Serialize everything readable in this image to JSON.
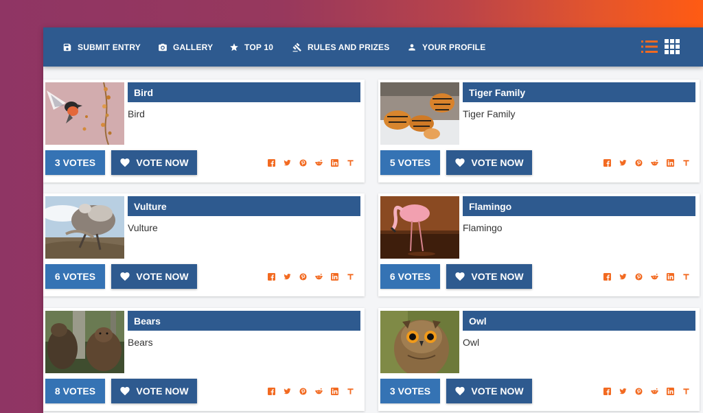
{
  "nav": {
    "items": [
      {
        "label": "SUBMIT ENTRY",
        "icon": "save-icon"
      },
      {
        "label": "GALLERY",
        "icon": "camera-icon"
      },
      {
        "label": "TOP 10",
        "icon": "star-icon"
      },
      {
        "label": "RULES AND PRIZES",
        "icon": "gavel-icon"
      },
      {
        "label": "YOUR PROFILE",
        "icon": "person-icon"
      }
    ],
    "views": [
      "list-view-icon",
      "grid-view-icon"
    ],
    "accent": "#f26a21",
    "bar_color": "#2e5a8f"
  },
  "entries": [
    {
      "title": "Bird",
      "description": "Bird",
      "votes": "3 VOTES",
      "vote_label": "VOTE NOW"
    },
    {
      "title": "Tiger Family",
      "description": "Tiger Family",
      "votes": "5 VOTES",
      "vote_label": "VOTE NOW"
    },
    {
      "title": "Vulture",
      "description": "Vulture",
      "votes": "6 VOTES",
      "vote_label": "VOTE NOW"
    },
    {
      "title": "Flamingo",
      "description": "Flamingo",
      "votes": "6 VOTES",
      "vote_label": "VOTE NOW"
    },
    {
      "title": "Bears",
      "description": "Bears",
      "votes": "8 VOTES",
      "vote_label": "VOTE NOW"
    },
    {
      "title": "Owl",
      "description": "Owl",
      "votes": "3 VOTES",
      "vote_label": "VOTE NOW"
    }
  ],
  "share_icons": [
    "facebook-icon",
    "twitter-icon",
    "pinterest-icon",
    "reddit-icon",
    "linkedin-icon",
    "tumblr-icon"
  ]
}
